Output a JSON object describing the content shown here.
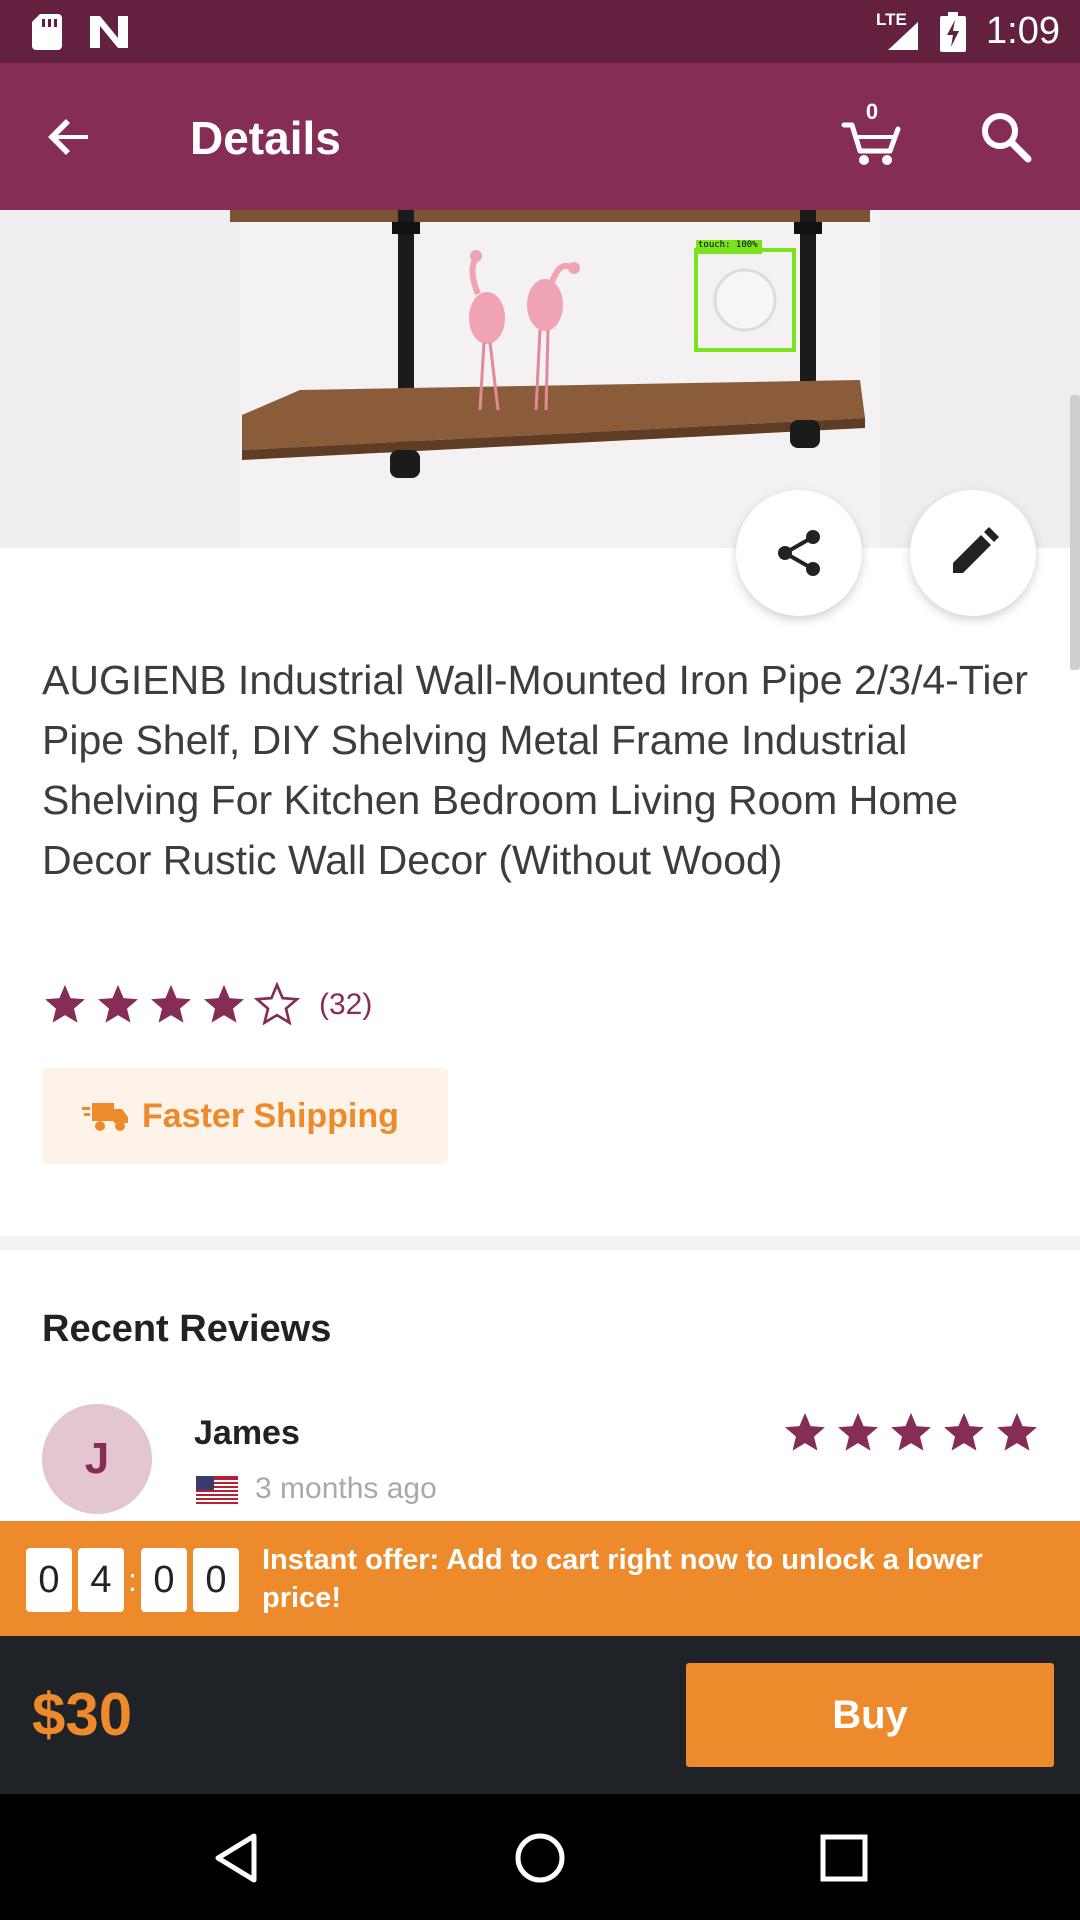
{
  "status_bar": {
    "network": "LTE",
    "time": "1:09"
  },
  "app_bar": {
    "title": "Details",
    "cart_count": "0"
  },
  "product": {
    "title": "AUGIENB Industrial Wall-Mounted Iron Pipe 2/3/4-Tier Pipe Shelf, DIY Shelving Metal Frame Industrial Shelving For Kitchen Bedroom Living Room Home Decor Rustic Wall Decor (Without Wood)",
    "rating": 4,
    "rating_max": 5,
    "review_count": "(32)",
    "shipping_badge": "Faster Shipping",
    "touch_label": "touch: 100%"
  },
  "reviews": {
    "heading": "Recent Reviews",
    "items": [
      {
        "avatar_initial": "J",
        "name": "James",
        "time": "3 months ago",
        "rating": 5
      }
    ]
  },
  "offer": {
    "timer_digits": [
      "0",
      "4",
      "0",
      "0"
    ],
    "timer_separator": ":",
    "text": "Instant offer: Add to cart right now to unlock a lower price!"
  },
  "purchase": {
    "price": "$30",
    "buy_label": "Buy"
  },
  "colors": {
    "status_bar": "#64203f",
    "app_bar": "#852d54",
    "accent": "#ed8a2b",
    "buy_bar": "#1f2226"
  },
  "icons": [
    "sd-card-icon",
    "n-notification-icon",
    "signal-icon",
    "battery-charging-icon",
    "back-arrow-icon",
    "cart-icon",
    "search-icon",
    "share-icon",
    "pencil-icon",
    "star-icon",
    "truck-icon",
    "us-flag-icon",
    "nav-back-icon",
    "nav-home-icon",
    "nav-recents-icon"
  ]
}
